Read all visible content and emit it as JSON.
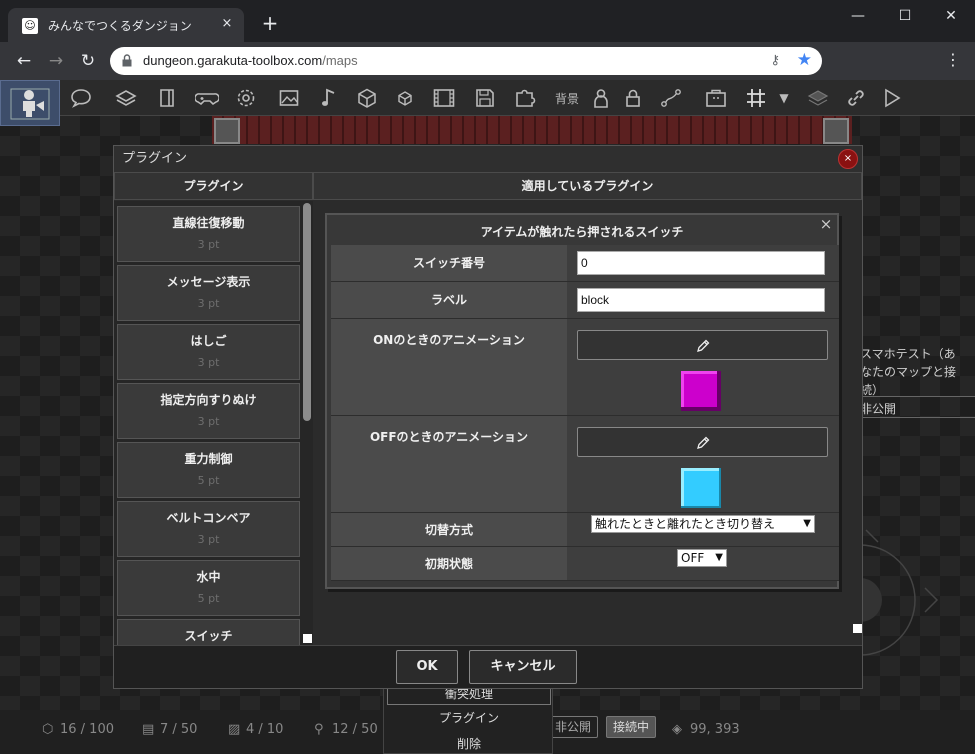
{
  "browser": {
    "tab_title": "みんなでつくるダンジョン",
    "url_host": "dungeon.garakuta-toolbox.com",
    "url_path": "/maps",
    "tab_close": "×",
    "new_tab": "+"
  },
  "toolbar": {
    "bg_label": "背景"
  },
  "background": {
    "side_text": [
      "スマホテスト（あ",
      "なたのマップと接",
      "続）",
      "非公開"
    ],
    "context_menu": [
      "衝突処理",
      "プラグイン",
      "削除"
    ],
    "status": {
      "cubes": "16 / 100",
      "frames": "7 / 50",
      "images": "4 / 10",
      "links": "12 / 50",
      "badge_private": "非公開",
      "badge_connected": "接続中",
      "coords": "99, 393"
    }
  },
  "dialog": {
    "title": "プラグイン",
    "close": "×",
    "left_header": "プラグイン",
    "right_header": "適用しているプラグイン",
    "plugins": [
      {
        "name": "直線往復移動",
        "pt": "3 pt"
      },
      {
        "name": "メッセージ表示",
        "pt": "3 pt"
      },
      {
        "name": "はしご",
        "pt": "3 pt"
      },
      {
        "name": "指定方向すりぬけ",
        "pt": "3 pt"
      },
      {
        "name": "重力制御",
        "pt": "5 pt"
      },
      {
        "name": "ベルトコンベア",
        "pt": "3 pt"
      },
      {
        "name": "水中",
        "pt": "5 pt"
      },
      {
        "name": "スイッチ",
        "pt": ""
      }
    ],
    "applied": {
      "title": "アイテムが触れたら押されるスイッチ",
      "close": "×",
      "fields": {
        "switch_no_label": "スイッチ番号",
        "switch_no_value": "0",
        "label_label": "ラベル",
        "label_value": "block",
        "on_anim_label": "ONのときのアニメーション",
        "off_anim_label": "OFFのときのアニメーション",
        "mode_label": "切替方式",
        "mode_value": "触れたときと離れたとき切り替え",
        "init_label": "初期状態",
        "init_value": "OFF"
      },
      "on_color": "#cc00cc",
      "off_color": "#33ccff"
    },
    "ok": "OK",
    "cancel": "キャンセル"
  }
}
